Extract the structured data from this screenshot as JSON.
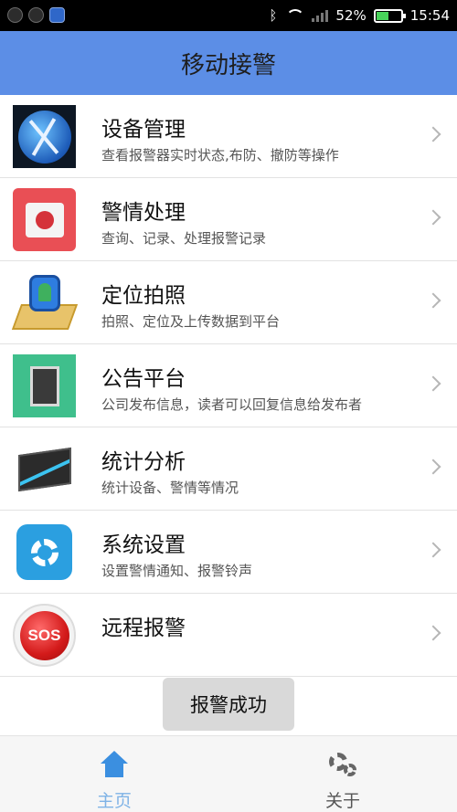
{
  "status_bar": {
    "battery": "52%",
    "time": "15:54",
    "icons": [
      "shield-app-icon",
      "lock-app-icon",
      "app-icon",
      "bluetooth-icon",
      "wifi-icon",
      "signal-icon",
      "battery-icon"
    ],
    "battery_level": 0.52,
    "battery_color": "#48d35a"
  },
  "header": {
    "title": "移动接警",
    "background": "#5c8ee6"
  },
  "menu": {
    "items": [
      {
        "title": "设备管理",
        "subtitle": "查看报警器实时状态,布防、撤防等操作",
        "icon": "device-globe-icon"
      },
      {
        "title": "警情处理",
        "subtitle": "查询、记录、处理报警记录",
        "icon": "alarm-box-icon"
      },
      {
        "title": "定位拍照",
        "subtitle": "拍照、定位及上传数据到平台",
        "icon": "map-pin-icon"
      },
      {
        "title": "公告平台",
        "subtitle": "公司发布信息，读者可以回复信息给发布者",
        "icon": "notice-board-icon"
      },
      {
        "title": "统计分析",
        "subtitle": "统计设备、警情等情况",
        "icon": "chart-icon"
      },
      {
        "title": "系统设置",
        "subtitle": "设置警情通知、报警铃声",
        "icon": "settings-gear-icon"
      },
      {
        "title": "远程报警",
        "subtitle": "",
        "icon": "sos-icon",
        "icon_text": "SOS"
      }
    ]
  },
  "toast": {
    "text": "报警成功"
  },
  "bottom_nav": {
    "tabs": [
      {
        "label": "主页",
        "icon": "home-icon",
        "active": true
      },
      {
        "label": "关于",
        "icon": "gears-icon",
        "active": false
      }
    ],
    "active_color": "#7fb3e6"
  }
}
